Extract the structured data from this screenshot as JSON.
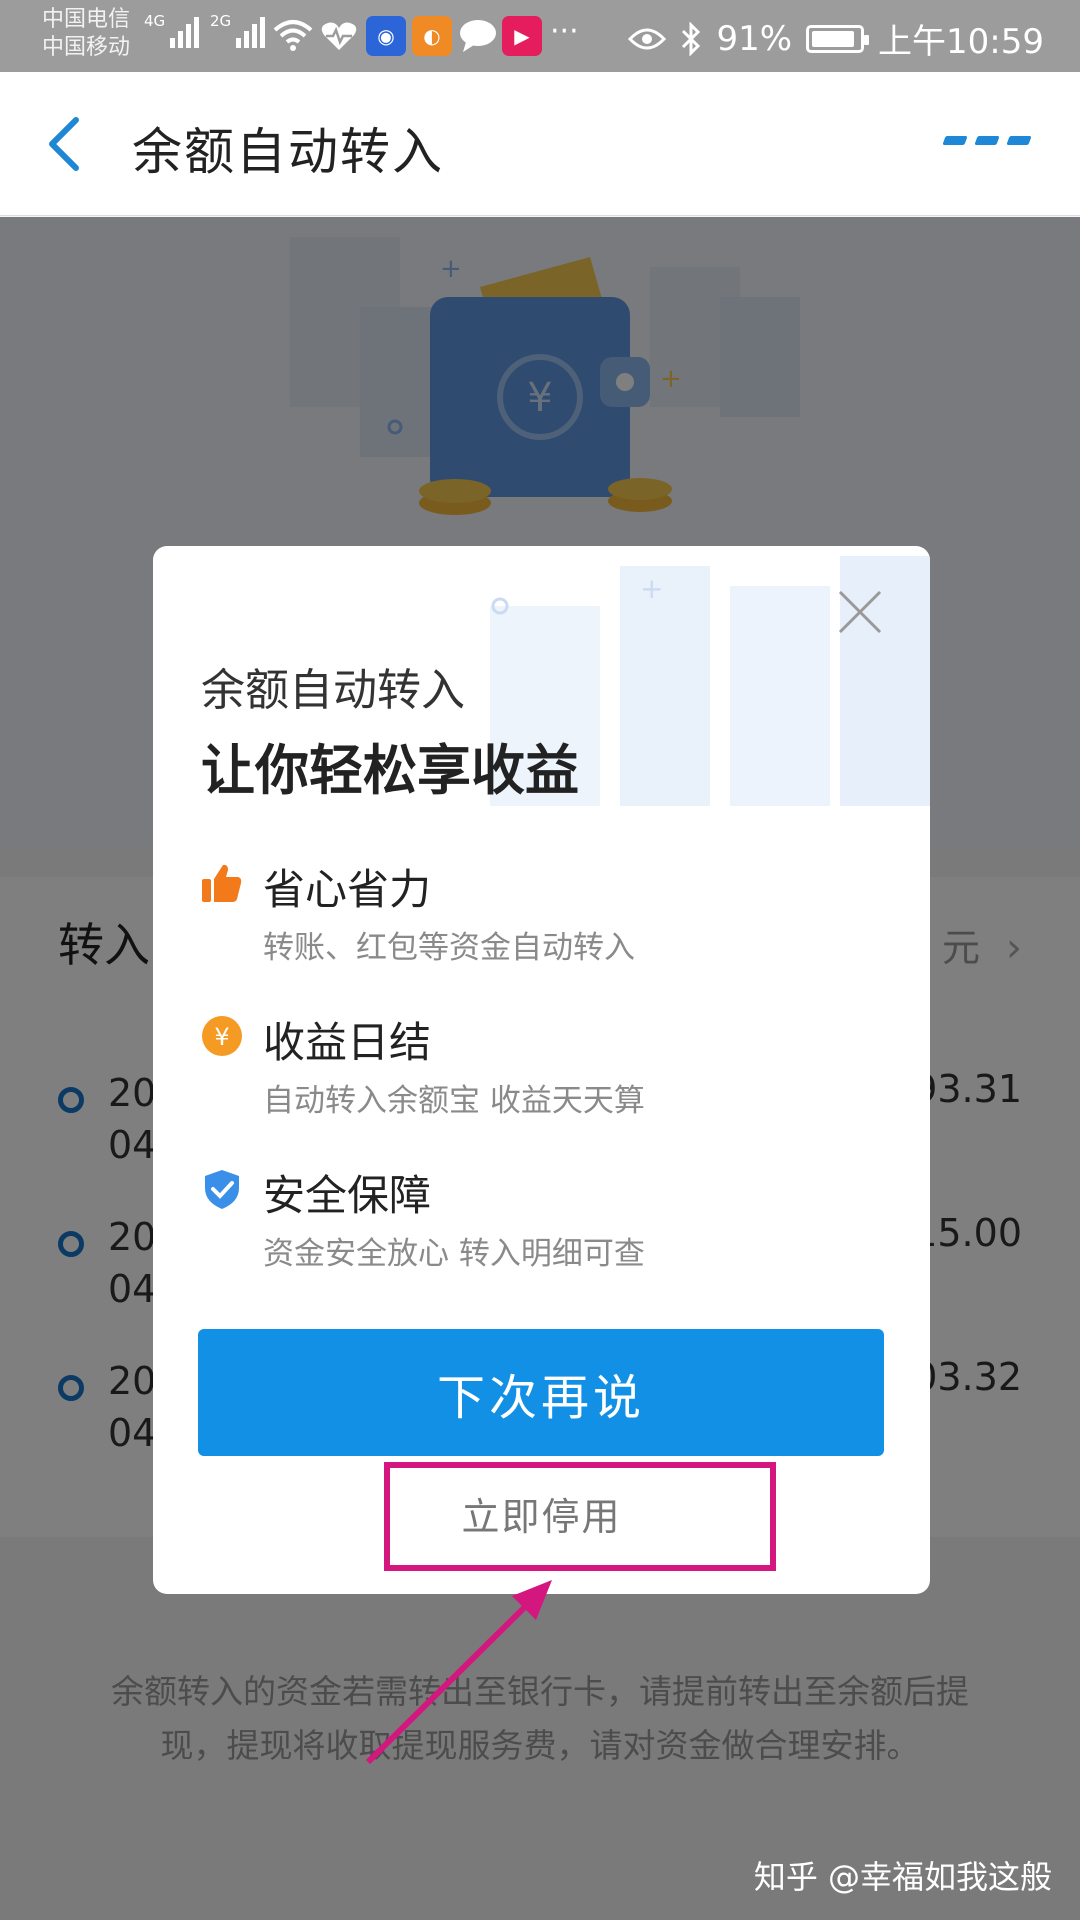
{
  "status_bar": {
    "carrier_1": "中国电信",
    "carrier_2": "中国移动",
    "net_1": "4G",
    "net_2": "2G",
    "battery": "91%",
    "time": "上午10:59"
  },
  "header": {
    "title": "余额自动转入"
  },
  "background_page": {
    "list_title": "转入",
    "list_total_unit": "元",
    "rows": [
      {
        "date_line_1": "20",
        "date_line_2": "04",
        "amount": "93.31"
      },
      {
        "date_line_1": "20",
        "date_line_2": "04",
        "amount": "15.00"
      },
      {
        "date_line_1": "20",
        "date_line_2": "04",
        "amount": "03.32"
      }
    ],
    "footnote": "余额转入的资金若需转出至银行卡，请提前转出至余额后提现，提现将收取提现服务费，请对资金做合理安排。"
  },
  "modal": {
    "subtitle": "余额自动转入",
    "headline": "让你轻松享收益",
    "features": [
      {
        "icon": "thumbs-up-icon",
        "title": "省心省力",
        "desc": "转账、红包等资金自动转入"
      },
      {
        "icon": "yuan-coin-icon",
        "title": "收益日结",
        "desc": "自动转入余额宝 收益天天算"
      },
      {
        "icon": "shield-check-icon",
        "title": "安全保障",
        "desc": "资金安全放心 转入明细可查"
      }
    ],
    "primary_button": "下次再说",
    "secondary_button": "立即停用"
  },
  "watermark": "知乎 @幸福如我这般",
  "colors": {
    "accent": "#1190e6",
    "annotation": "#d4177f"
  }
}
